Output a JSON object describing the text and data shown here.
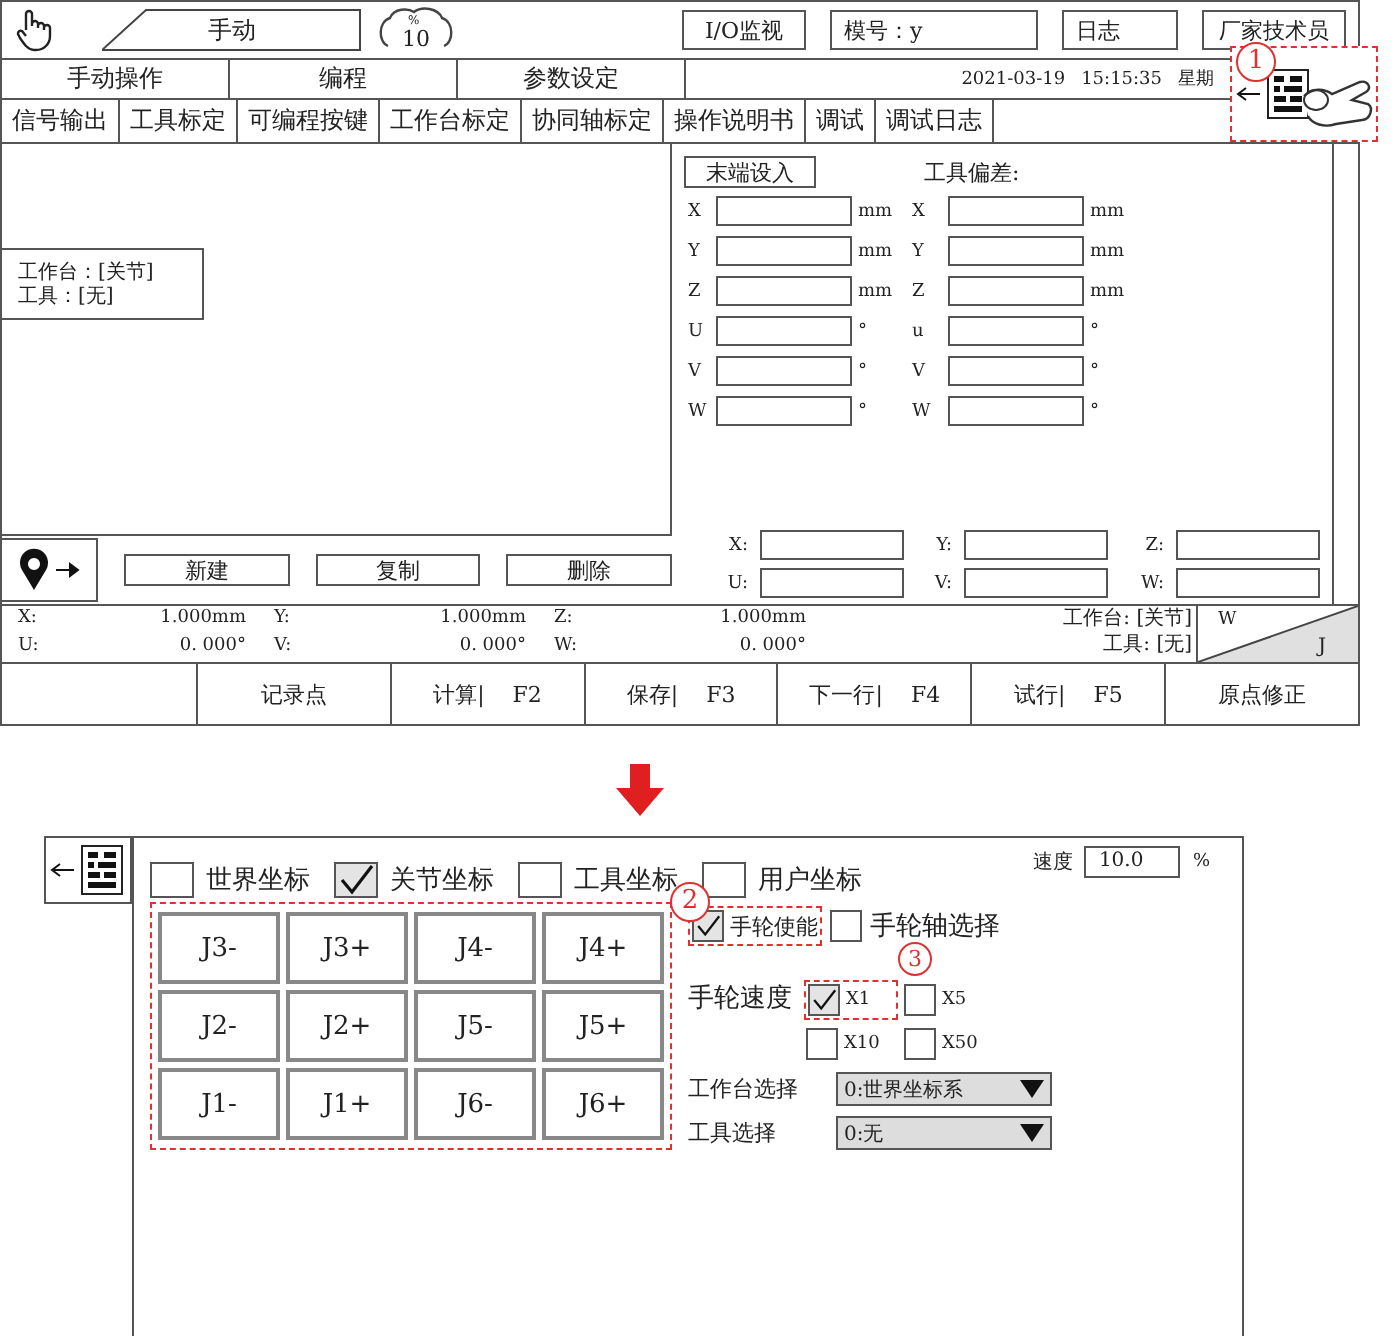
{
  "manual_screen": {
    "mode_label": "手动",
    "speed_value": "10",
    "speed_unit": "%",
    "header_buttons": [
      "I/O监视",
      "模号：y",
      "日志",
      "厂家技术员"
    ],
    "tabs": [
      "手动操作",
      "编程",
      "参数设定"
    ],
    "date": "2021-03-19",
    "time": "15:15:35",
    "weekday": "星期",
    "sub_tabs": [
      "信号输出",
      "工具标定",
      "可编程按键",
      "工作台标定",
      "协同轴标定",
      "操作说明书",
      "调试",
      "调试日志"
    ],
    "info_box": [
      "工作台：[关节]",
      "工具：[无]"
    ],
    "end_set_button": "末端设入",
    "end_fields": [
      {
        "axis": "X",
        "unit": "mm"
      },
      {
        "axis": "Y",
        "unit": "mm"
      },
      {
        "axis": "Z",
        "unit": "mm"
      },
      {
        "axis": "U",
        "unit": "°"
      },
      {
        "axis": "V",
        "unit": "°"
      },
      {
        "axis": "W",
        "unit": "°"
      }
    ],
    "tool_offset_title": "工具偏差:",
    "tool_offset_fields": [
      {
        "axis": "X",
        "unit": "mm"
      },
      {
        "axis": "Y",
        "unit": "mm"
      },
      {
        "axis": "Z",
        "unit": "mm"
      },
      {
        "axis": "u",
        "unit": "°"
      },
      {
        "axis": "V",
        "unit": "°"
      },
      {
        "axis": "W",
        "unit": "°"
      }
    ],
    "point_buttons": [
      "新建",
      "复制",
      "删除"
    ],
    "point_fields": [
      "X:",
      "Y:",
      "Z:",
      "U:",
      "V:",
      "W:"
    ],
    "positions": [
      {
        "axis": "X:",
        "value": "1.000mm"
      },
      {
        "axis": "Y:",
        "value": "1.000mm"
      },
      {
        "axis": "Z:",
        "value": "1.000mm"
      },
      {
        "axis": "U:",
        "value": "0. 000°"
      },
      {
        "axis": "V:",
        "value": "0. 000°"
      },
      {
        "axis": "W:",
        "value": "0. 000°"
      }
    ],
    "position_info": [
      "工作台: [关节]",
      "工具: [无]"
    ],
    "frame_toggle": [
      "W",
      "J"
    ],
    "function_keys": [
      {
        "label": "记录点"
      },
      {
        "label": "计算|",
        "key": "F2"
      },
      {
        "label": "保存|",
        "key": "F3"
      },
      {
        "label": "下一行|",
        "key": "F4"
      },
      {
        "label": "试行|",
        "key": "F5"
      },
      {
        "label": "原点修正"
      }
    ]
  },
  "callouts": [
    "1",
    "2",
    "3"
  ],
  "jog_screen": {
    "coordinate_modes": [
      {
        "label": "世界坐标",
        "checked": false
      },
      {
        "label": "关节坐标",
        "checked": true
      },
      {
        "label": "工具坐标",
        "checked": false
      },
      {
        "label": "用户坐标",
        "checked": false
      }
    ],
    "speed_label": "速度",
    "speed_value": "10.0",
    "speed_unit": "%",
    "jog_buttons": [
      "J3-",
      "J3+",
      "J4-",
      "J4+",
      "J2-",
      "J2+",
      "J5-",
      "J5+",
      "J1-",
      "J1+",
      "J6-",
      "J6+"
    ],
    "handwheel_enable": {
      "label": "手轮使能",
      "checked": true
    },
    "handwheel_axis": {
      "label": "手轮轴选择",
      "checked": false
    },
    "handwheel_speed_label": "手轮速度",
    "handwheel_speeds": [
      {
        "label": "X1",
        "checked": true
      },
      {
        "label": "X5",
        "checked": false
      },
      {
        "label": "X10",
        "checked": false
      },
      {
        "label": "X50",
        "checked": false
      }
    ],
    "workbench_select": {
      "label": "工作台选择",
      "value": "0:世界坐标系"
    },
    "tool_select": {
      "label": "工具选择",
      "value": "0:无"
    }
  }
}
